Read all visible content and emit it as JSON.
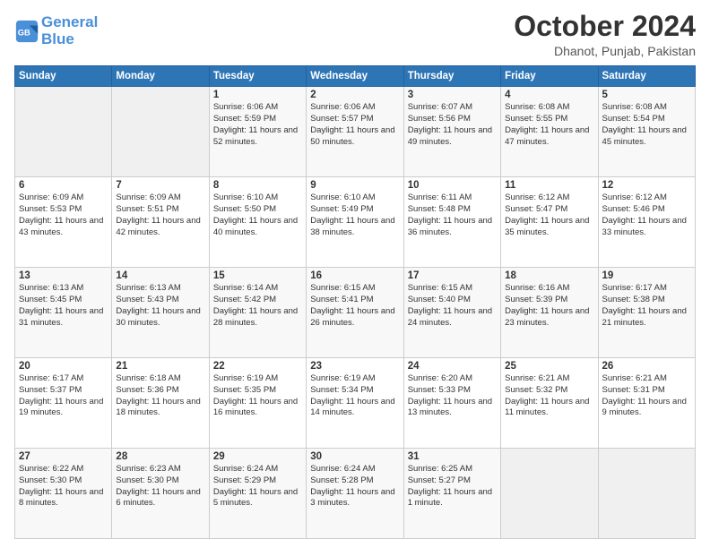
{
  "header": {
    "logo_line1": "General",
    "logo_line2": "Blue",
    "month": "October 2024",
    "location": "Dhanot, Punjab, Pakistan"
  },
  "weekdays": [
    "Sunday",
    "Monday",
    "Tuesday",
    "Wednesday",
    "Thursday",
    "Friday",
    "Saturday"
  ],
  "rows": [
    [
      {
        "day": "",
        "info": ""
      },
      {
        "day": "",
        "info": ""
      },
      {
        "day": "1",
        "info": "Sunrise: 6:06 AM\nSunset: 5:59 PM\nDaylight: 11 hours and 52 minutes."
      },
      {
        "day": "2",
        "info": "Sunrise: 6:06 AM\nSunset: 5:57 PM\nDaylight: 11 hours and 50 minutes."
      },
      {
        "day": "3",
        "info": "Sunrise: 6:07 AM\nSunset: 5:56 PM\nDaylight: 11 hours and 49 minutes."
      },
      {
        "day": "4",
        "info": "Sunrise: 6:08 AM\nSunset: 5:55 PM\nDaylight: 11 hours and 47 minutes."
      },
      {
        "day": "5",
        "info": "Sunrise: 6:08 AM\nSunset: 5:54 PM\nDaylight: 11 hours and 45 minutes."
      }
    ],
    [
      {
        "day": "6",
        "info": "Sunrise: 6:09 AM\nSunset: 5:53 PM\nDaylight: 11 hours and 43 minutes."
      },
      {
        "day": "7",
        "info": "Sunrise: 6:09 AM\nSunset: 5:51 PM\nDaylight: 11 hours and 42 minutes."
      },
      {
        "day": "8",
        "info": "Sunrise: 6:10 AM\nSunset: 5:50 PM\nDaylight: 11 hours and 40 minutes."
      },
      {
        "day": "9",
        "info": "Sunrise: 6:10 AM\nSunset: 5:49 PM\nDaylight: 11 hours and 38 minutes."
      },
      {
        "day": "10",
        "info": "Sunrise: 6:11 AM\nSunset: 5:48 PM\nDaylight: 11 hours and 36 minutes."
      },
      {
        "day": "11",
        "info": "Sunrise: 6:12 AM\nSunset: 5:47 PM\nDaylight: 11 hours and 35 minutes."
      },
      {
        "day": "12",
        "info": "Sunrise: 6:12 AM\nSunset: 5:46 PM\nDaylight: 11 hours and 33 minutes."
      }
    ],
    [
      {
        "day": "13",
        "info": "Sunrise: 6:13 AM\nSunset: 5:45 PM\nDaylight: 11 hours and 31 minutes."
      },
      {
        "day": "14",
        "info": "Sunrise: 6:13 AM\nSunset: 5:43 PM\nDaylight: 11 hours and 30 minutes."
      },
      {
        "day": "15",
        "info": "Sunrise: 6:14 AM\nSunset: 5:42 PM\nDaylight: 11 hours and 28 minutes."
      },
      {
        "day": "16",
        "info": "Sunrise: 6:15 AM\nSunset: 5:41 PM\nDaylight: 11 hours and 26 minutes."
      },
      {
        "day": "17",
        "info": "Sunrise: 6:15 AM\nSunset: 5:40 PM\nDaylight: 11 hours and 24 minutes."
      },
      {
        "day": "18",
        "info": "Sunrise: 6:16 AM\nSunset: 5:39 PM\nDaylight: 11 hours and 23 minutes."
      },
      {
        "day": "19",
        "info": "Sunrise: 6:17 AM\nSunset: 5:38 PM\nDaylight: 11 hours and 21 minutes."
      }
    ],
    [
      {
        "day": "20",
        "info": "Sunrise: 6:17 AM\nSunset: 5:37 PM\nDaylight: 11 hours and 19 minutes."
      },
      {
        "day": "21",
        "info": "Sunrise: 6:18 AM\nSunset: 5:36 PM\nDaylight: 11 hours and 18 minutes."
      },
      {
        "day": "22",
        "info": "Sunrise: 6:19 AM\nSunset: 5:35 PM\nDaylight: 11 hours and 16 minutes."
      },
      {
        "day": "23",
        "info": "Sunrise: 6:19 AM\nSunset: 5:34 PM\nDaylight: 11 hours and 14 minutes."
      },
      {
        "day": "24",
        "info": "Sunrise: 6:20 AM\nSunset: 5:33 PM\nDaylight: 11 hours and 13 minutes."
      },
      {
        "day": "25",
        "info": "Sunrise: 6:21 AM\nSunset: 5:32 PM\nDaylight: 11 hours and 11 minutes."
      },
      {
        "day": "26",
        "info": "Sunrise: 6:21 AM\nSunset: 5:31 PM\nDaylight: 11 hours and 9 minutes."
      }
    ],
    [
      {
        "day": "27",
        "info": "Sunrise: 6:22 AM\nSunset: 5:30 PM\nDaylight: 11 hours and 8 minutes."
      },
      {
        "day": "28",
        "info": "Sunrise: 6:23 AM\nSunset: 5:30 PM\nDaylight: 11 hours and 6 minutes."
      },
      {
        "day": "29",
        "info": "Sunrise: 6:24 AM\nSunset: 5:29 PM\nDaylight: 11 hours and 5 minutes."
      },
      {
        "day": "30",
        "info": "Sunrise: 6:24 AM\nSunset: 5:28 PM\nDaylight: 11 hours and 3 minutes."
      },
      {
        "day": "31",
        "info": "Sunrise: 6:25 AM\nSunset: 5:27 PM\nDaylight: 11 hours and 1 minute."
      },
      {
        "day": "",
        "info": ""
      },
      {
        "day": "",
        "info": ""
      }
    ]
  ]
}
